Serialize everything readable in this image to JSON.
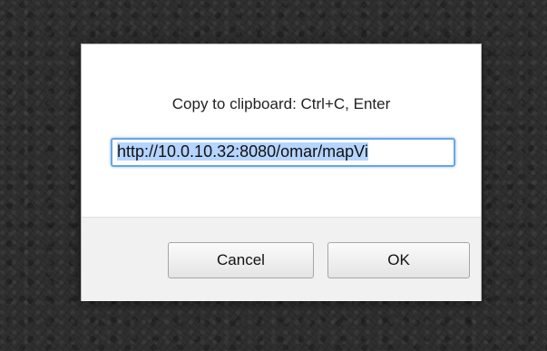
{
  "dialog": {
    "message": "Copy to clipboard: Ctrl+C, Enter",
    "url_value": "http://10.0.10.32:8080/omar/mapVi",
    "cancel_label": "Cancel",
    "ok_label": "OK"
  },
  "colors": {
    "input_focus_border": "#6ba4e6",
    "selection_highlight": "#b5d5ff",
    "footer_background": "#f1f1f1"
  }
}
